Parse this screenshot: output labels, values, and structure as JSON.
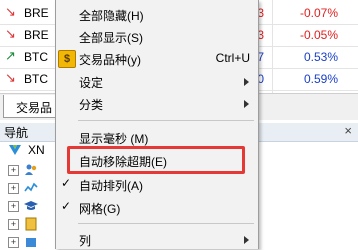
{
  "market_watch": {
    "rows": [
      {
        "arrow": "↘",
        "dir": "down",
        "symbol": "BRE",
        "p1": "3",
        "p1_color": "red",
        "change": "-0.07%",
        "change_color": "red"
      },
      {
        "arrow": "↘",
        "dir": "down",
        "symbol": "BRE",
        "p1": "3",
        "p1_color": "red",
        "change": "-0.05%",
        "change_color": "red"
      },
      {
        "arrow": "↗",
        "dir": "up",
        "symbol": "BTC",
        "p1": "7",
        "p1_color": "blue",
        "change": "0.53%",
        "change_color": "blue"
      },
      {
        "arrow": "↘",
        "dir": "down",
        "symbol": "BTC",
        "p1": "0",
        "p1_color": "blue",
        "change": "0.59%",
        "change_color": "blue"
      }
    ],
    "tab_label": "交易品"
  },
  "navigator": {
    "title": "导航",
    "close": "×",
    "root_label": "XN"
  },
  "context_menu": {
    "items": [
      {
        "label": "全部隐藏(H)"
      },
      {
        "label": "全部显示(S)"
      },
      {
        "label": "交易品种(y)",
        "shortcut": "Ctrl+U"
      },
      {
        "label": "设定"
      },
      {
        "label": "分类"
      },
      {
        "label": "显示毫秒 (M)"
      },
      {
        "label": "自动移除超期(E)"
      },
      {
        "label": "自动排列(A)"
      },
      {
        "label": "网格(G)"
      },
      {
        "label": "列"
      }
    ],
    "checkmark": "✓",
    "dollar_glyph": "$"
  },
  "colors": {
    "highlight_border": "#e53935",
    "up": "#1a8a3a",
    "down": "#d33333",
    "blue_value": "#1a3fc7"
  }
}
